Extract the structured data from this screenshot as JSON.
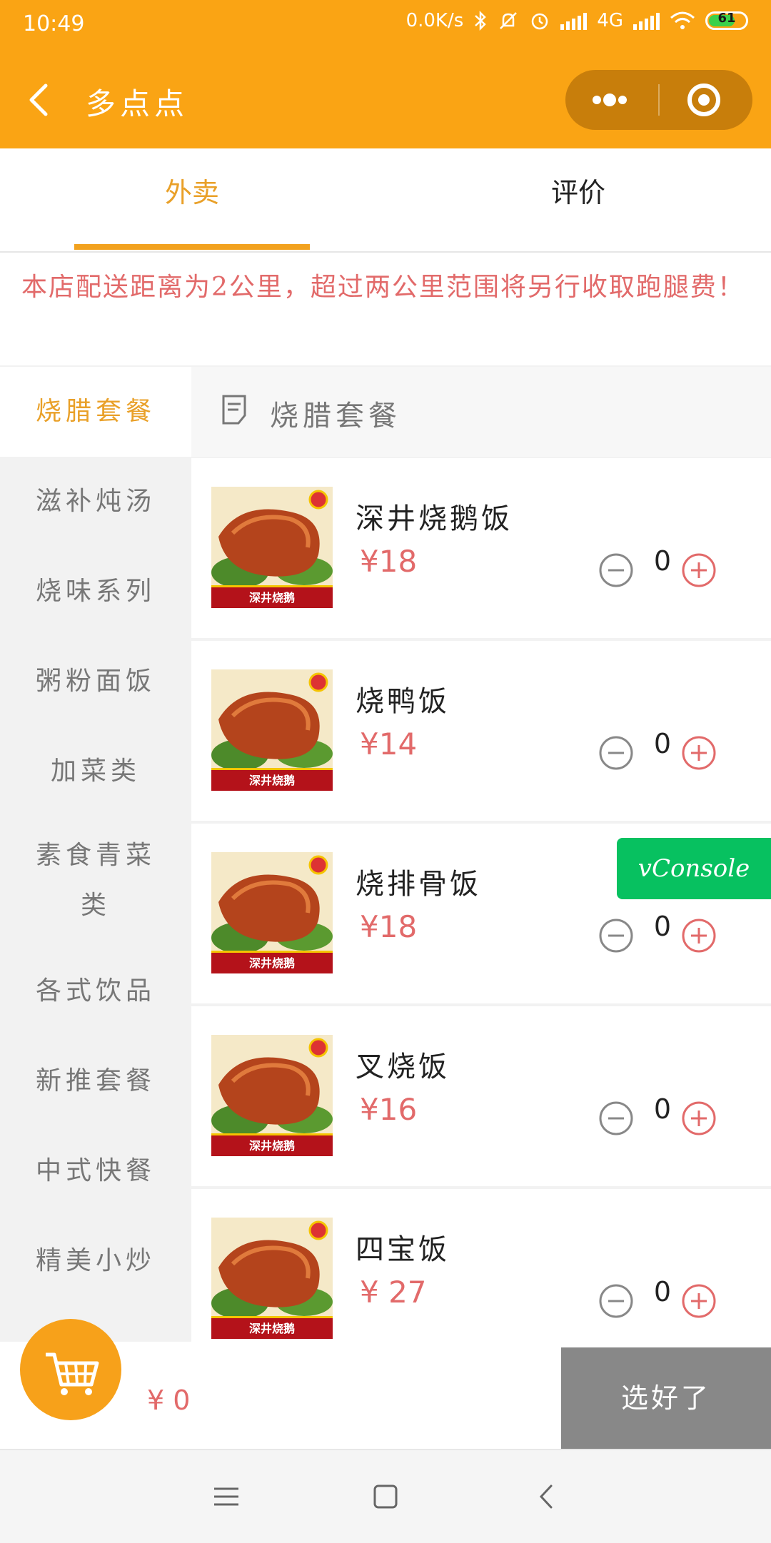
{
  "status_bar": {
    "time": "10:49",
    "net_speed": "0.0K/s",
    "network": "4G",
    "battery": "61"
  },
  "nav": {
    "title": "多点点"
  },
  "tabs": [
    {
      "label": "外卖",
      "active": true
    },
    {
      "label": "评价",
      "active": false
    }
  ],
  "notice": "本店配送距离为2公里，超过两公里范围将另行收取跑腿费！",
  "sidebar": {
    "items": [
      {
        "label": "烧腊套餐",
        "active": true
      },
      {
        "label": "滋补炖汤"
      },
      {
        "label": "烧味系列"
      },
      {
        "label": "粥粉面饭"
      },
      {
        "label": "加菜类"
      },
      {
        "label": "素食青菜类"
      },
      {
        "label": "各式饮品"
      },
      {
        "label": "新推套餐"
      },
      {
        "label": "中式快餐"
      },
      {
        "label": "精美小炒"
      }
    ]
  },
  "section": {
    "title": "烧腊套餐"
  },
  "dishes": [
    {
      "name": "深井烧鹅饭",
      "price": "¥18",
      "qty": "0",
      "image_caption": "深井烧鹅"
    },
    {
      "name": "烧鸭饭",
      "price": "¥14",
      "qty": "0",
      "image_caption": "深井烧鹅"
    },
    {
      "name": "烧排骨饭",
      "price": "¥18",
      "qty": "0",
      "image_caption": "深井烧鹅"
    },
    {
      "name": "叉烧饭",
      "price": "¥16",
      "qty": "0",
      "image_caption": "深井烧鹅"
    },
    {
      "name": "四宝饭",
      "price": "¥ 27",
      "qty": "0",
      "image_caption": "深井烧鹅"
    }
  ],
  "vconsole": "vConsole",
  "cart": {
    "total": "¥ 0",
    "checkout_label": "选好了"
  },
  "colors": {
    "brand": "#faa414",
    "price": "#e26a6a",
    "active_tab": "#e9a028",
    "vconsole": "#07c160"
  }
}
